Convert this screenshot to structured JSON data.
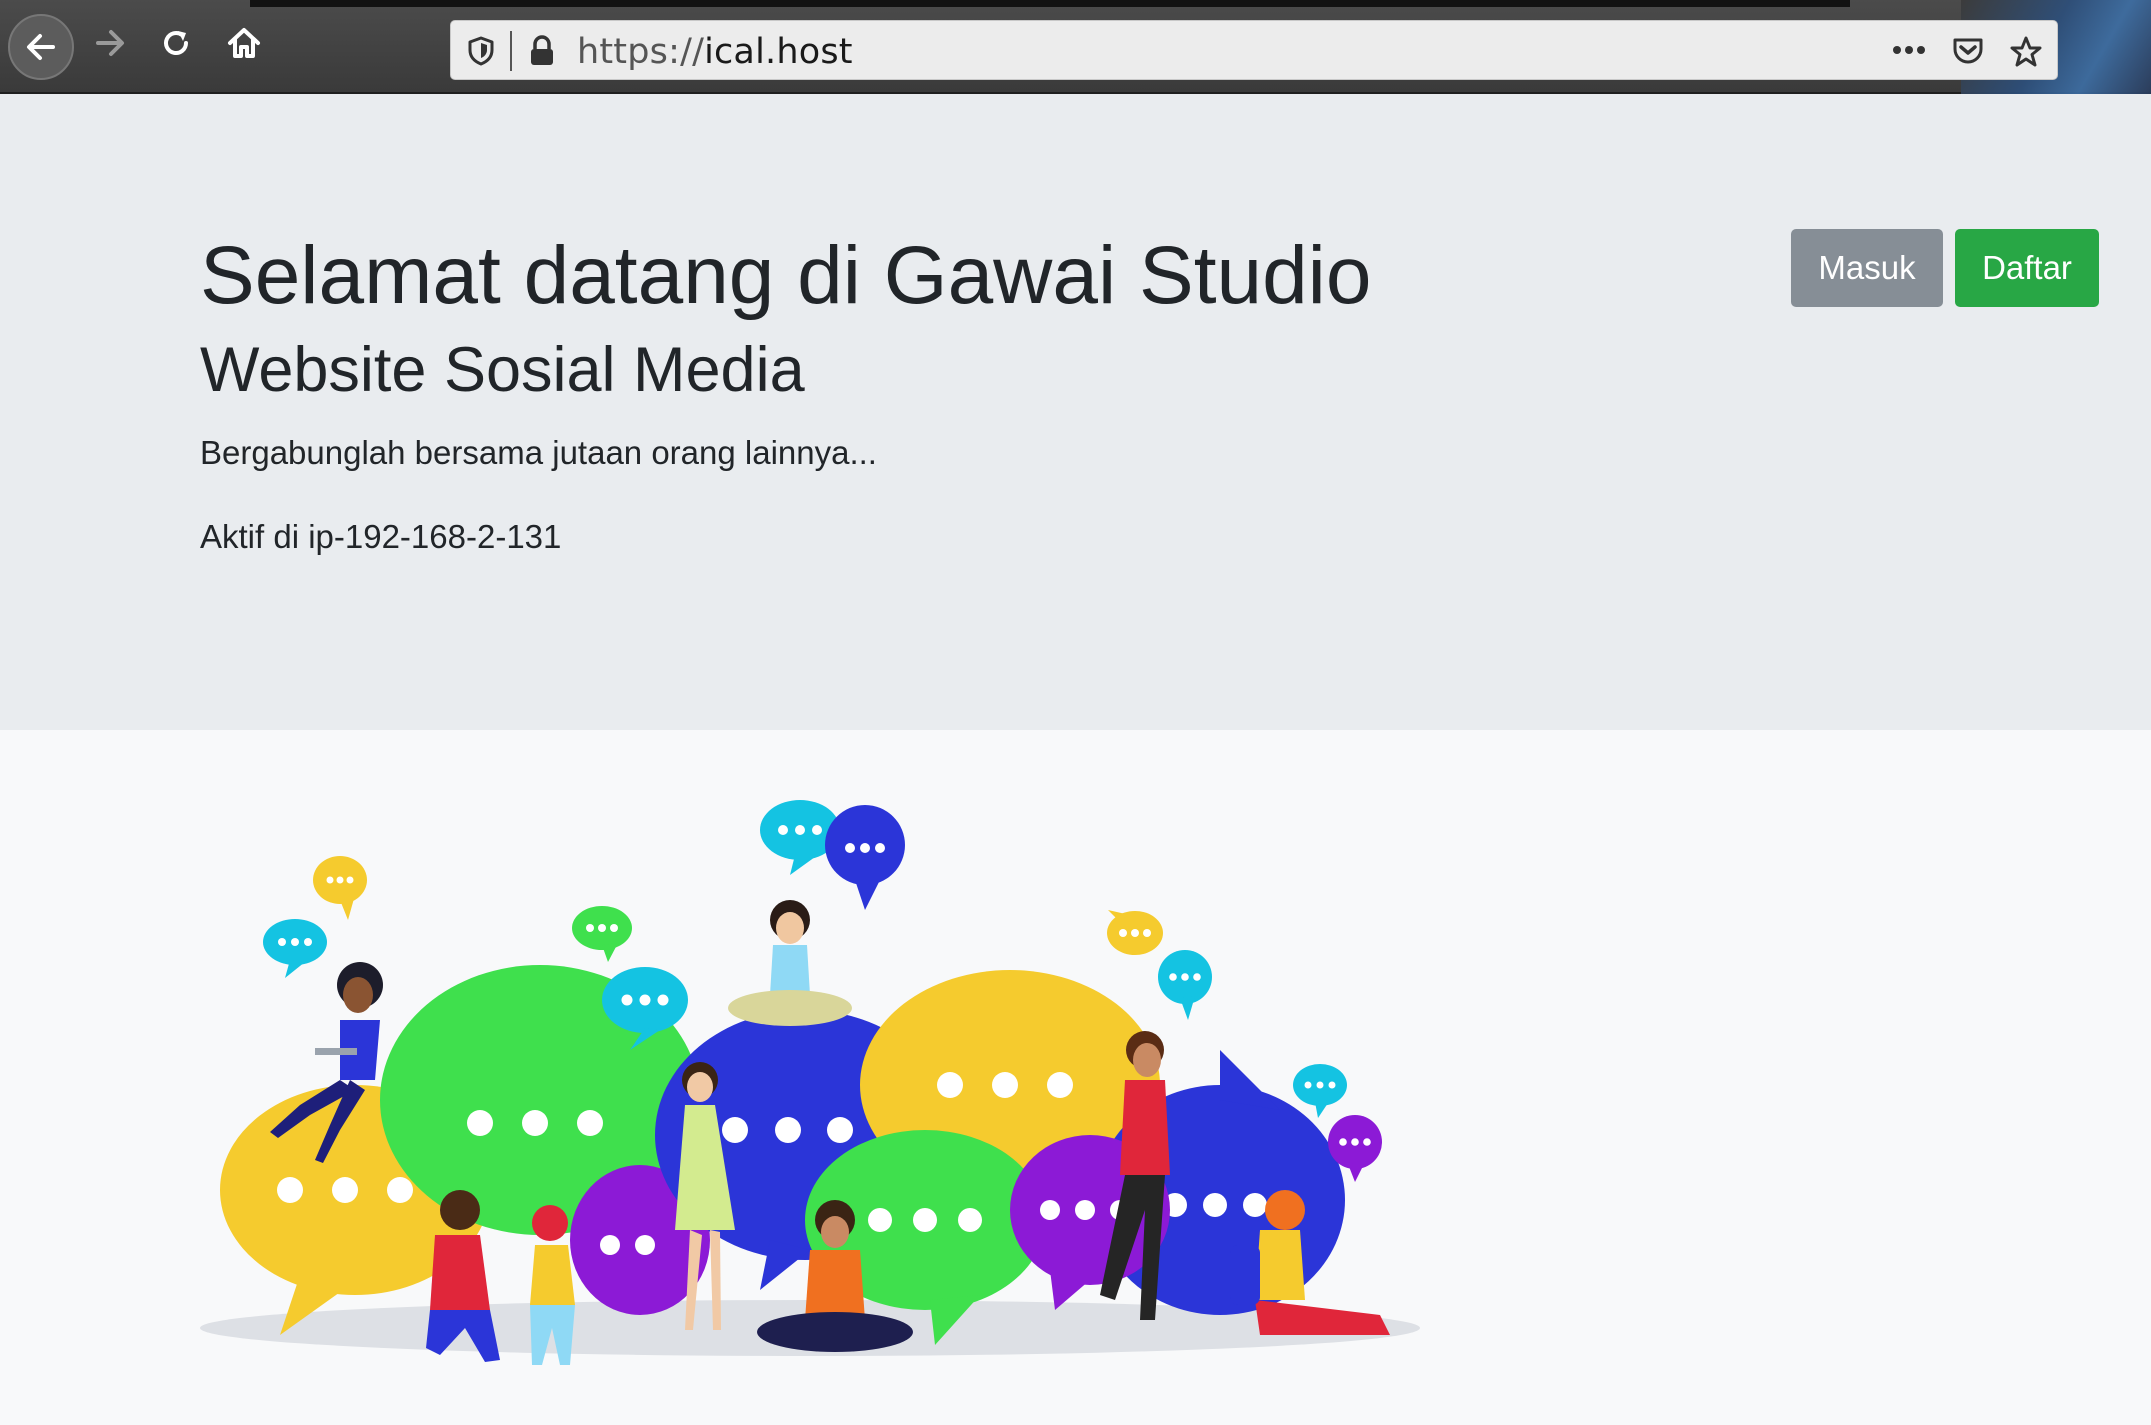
{
  "browser": {
    "url_scheme": "https://",
    "url_host": "ical.host",
    "icons": {
      "back": "arrow-left-icon",
      "forward": "arrow-right-icon",
      "reload": "reload-icon",
      "home": "home-icon",
      "tracking": "shield-icon",
      "lock": "lock-icon",
      "page_actions": "more-icon",
      "pocket": "pocket-icon",
      "bookmark": "star-icon"
    }
  },
  "hero": {
    "title": "Selamat datang di Gawai Studio",
    "subtitle": "Website Sosial Media",
    "lead": "Bergabunglah bersama jutaan orang lainnya...",
    "active_text": "Aktif di ip-192-168-2-131"
  },
  "auth": {
    "login_label": "Masuk",
    "register_label": "Daftar"
  },
  "colors": {
    "jumbotron_bg": "#e9ecef",
    "page_bg": "#f8f9fa",
    "login_btn": "#868e96",
    "register_btn": "#28a745"
  }
}
